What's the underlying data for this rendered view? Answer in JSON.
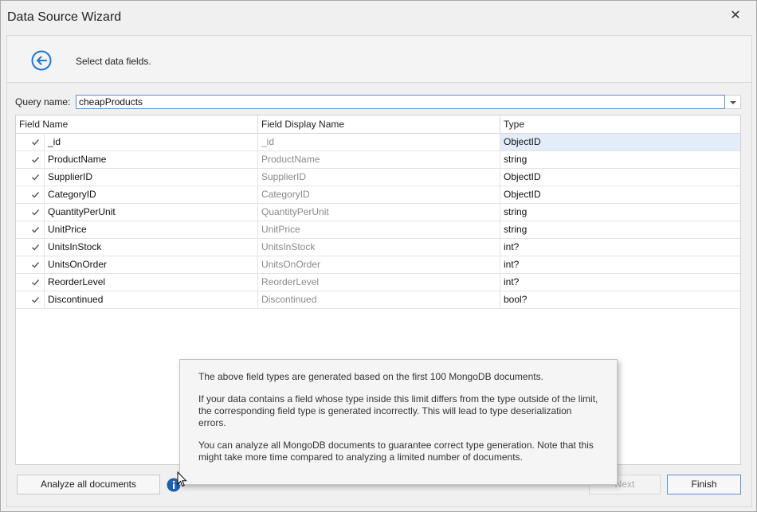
{
  "window": {
    "title": "Data Source Wizard",
    "close_glyph": "✕"
  },
  "header": {
    "back_icon": "back-arrow-circle-icon",
    "subtitle": "Select data fields."
  },
  "query": {
    "label": "Query name:",
    "value": "cheapProducts"
  },
  "grid": {
    "columns": [
      "Field Name",
      "Field Display Name",
      "Type"
    ],
    "rows": [
      {
        "name": "_id",
        "display": "_id",
        "type": "ObjectID",
        "checked": true
      },
      {
        "name": "ProductName",
        "display": "ProductName",
        "type": "string",
        "checked": true
      },
      {
        "name": "SupplierID",
        "display": "SupplierID",
        "type": "ObjectID",
        "checked": true
      },
      {
        "name": "CategoryID",
        "display": "CategoryID",
        "type": "ObjectID",
        "checked": true
      },
      {
        "name": "QuantityPerUnit",
        "display": "QuantityPerUnit",
        "type": "string",
        "checked": true
      },
      {
        "name": "UnitPrice",
        "display": "UnitPrice",
        "type": "string",
        "checked": true
      },
      {
        "name": "UnitsInStock",
        "display": "UnitsInStock",
        "type": "int?",
        "checked": true
      },
      {
        "name": "UnitsOnOrder",
        "display": "UnitsOnOrder",
        "type": "int?",
        "checked": true
      },
      {
        "name": "ReorderLevel",
        "display": "ReorderLevel",
        "type": "int?",
        "checked": true
      },
      {
        "name": "Discontinued",
        "display": "Discontinued",
        "type": "bool?",
        "checked": true
      }
    ]
  },
  "tooltip": {
    "p1": "The above field types are generated based on the first 100 MongoDB documents.",
    "p2": "If your data contains a field whose type inside this limit differs from the type outside of the limit, the corresponding field type is generated incorrectly. This will lead to type deserialization errors.",
    "p3": "You can analyze all MongoDB documents to guarantee correct type generation. Note that this might take more time compared to analyzing a limited number of documents."
  },
  "footer": {
    "analyze_label": "Analyze all documents",
    "next_label": "Next",
    "finish_label": "Finish",
    "info_icon": "info-icon"
  },
  "colors": {
    "accent": "#1e78d4",
    "selection": "#e3edf9",
    "muted_text": "#8a8a8a"
  }
}
